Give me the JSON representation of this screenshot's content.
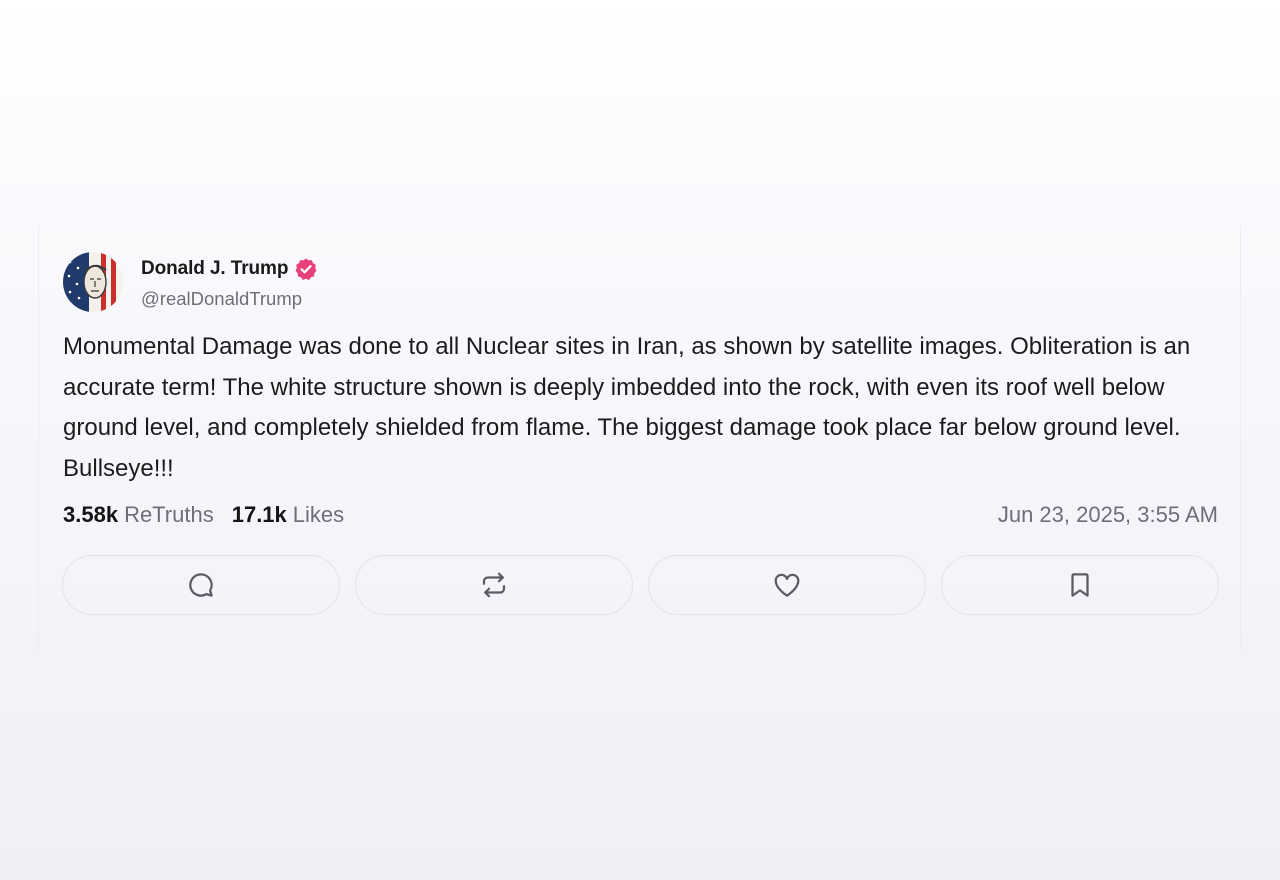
{
  "post": {
    "author": {
      "display_name": "Donald J. Trump",
      "handle": "@realDonaldTrump",
      "verified": true,
      "avatar_icon": "flag-portrait-avatar"
    },
    "text": "Monumental Damage was done to all Nuclear sites in Iran, as shown by satellite images. Obliteration is an accurate term! The white structure shown is deeply imbedded into the rock, with even its roof well below ground level, and completely shielded from flame. The biggest damage took place far below ground level. Bullseye!!!",
    "stats": {
      "retruths_count": "3.58k",
      "retruths_label": "ReTruths",
      "likes_count": "17.1k",
      "likes_label": "Likes"
    },
    "timestamp": "Jun 23, 2025, 3:55 AM",
    "actions": [
      {
        "name": "reply",
        "icon": "comment-icon"
      },
      {
        "name": "retruth",
        "icon": "repost-icon"
      },
      {
        "name": "like",
        "icon": "heart-icon"
      },
      {
        "name": "bookmark",
        "icon": "bookmark-icon"
      }
    ]
  },
  "colors": {
    "verified_badge": "#e8407a",
    "muted_text": "#6e6e7a",
    "button_border": "#e3e3ea",
    "icon": "#5b5b66"
  }
}
